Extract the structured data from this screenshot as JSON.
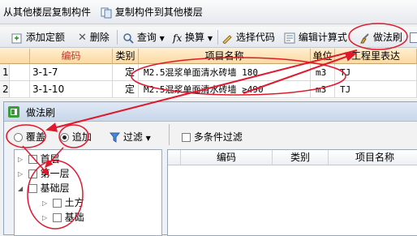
{
  "top_ribbon": {
    "copy_from_floor": "从其他楼层复制构件",
    "copy_to_floor": "复制构件到其他楼层"
  },
  "toolbar": {
    "add_quota": "添加定额",
    "delete": "删除",
    "query": "查询",
    "convert": "换算",
    "select_code": "选择代码",
    "edit_formula": "编辑计算式",
    "method_brush": "做法刷"
  },
  "grid": {
    "columns": [
      "编码",
      "类别",
      "项目名称",
      "单位",
      "工程里表达"
    ],
    "rows": [
      {
        "index": "1",
        "code": "3-1-7",
        "category": "定",
        "name": "M2.5混浆单面清水砖墙 180",
        "unit": "m3",
        "expr": "TJ"
      },
      {
        "index": "2",
        "code": "3-1-10",
        "category": "定",
        "name": "M2.5混浆单面清水砖墙 ≥490",
        "unit": "m3",
        "expr": "TJ"
      }
    ]
  },
  "dialog": {
    "title": "做法刷",
    "overwrite_label": "覆盖",
    "append_label": "追加",
    "filter_label": "过滤",
    "multi_filter_label": "多条件过滤",
    "tree": [
      {
        "label": "首层"
      },
      {
        "label": "第一层"
      },
      {
        "label": "基础层"
      },
      {
        "label": "土方"
      },
      {
        "label": "基础"
      }
    ],
    "columns": [
      "编码",
      "类别",
      "项目名称"
    ]
  },
  "colors": {
    "annotation_red": "#e0182d",
    "header_orange": "#fcd9a1"
  }
}
